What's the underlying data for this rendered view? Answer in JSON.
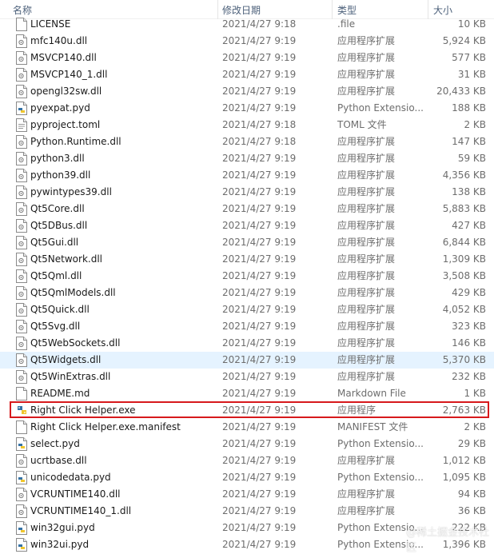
{
  "columns": {
    "name": "名称",
    "date": "修改日期",
    "type": "类型",
    "size": "大小"
  },
  "files": [
    {
      "name": "LICENSE",
      "date": "2021/4/27 9:18",
      "type": ".file",
      "size": "10 KB",
      "icon": "file-icon"
    },
    {
      "name": "mfc140u.dll",
      "date": "2021/4/27 9:19",
      "type": "应用程序扩展",
      "size": "5,924 KB",
      "icon": "dll-icon"
    },
    {
      "name": "MSVCP140.dll",
      "date": "2021/4/27 9:19",
      "type": "应用程序扩展",
      "size": "577 KB",
      "icon": "dll-icon"
    },
    {
      "name": "MSVCP140_1.dll",
      "date": "2021/4/27 9:19",
      "type": "应用程序扩展",
      "size": "31 KB",
      "icon": "dll-icon"
    },
    {
      "name": "opengl32sw.dll",
      "date": "2021/4/27 9:19",
      "type": "应用程序扩展",
      "size": "20,433 KB",
      "icon": "dll-icon"
    },
    {
      "name": "pyexpat.pyd",
      "date": "2021/4/27 9:19",
      "type": "Python Extensio...",
      "size": "188 KB",
      "icon": "python-icon"
    },
    {
      "name": "pyproject.toml",
      "date": "2021/4/27 9:18",
      "type": "TOML 文件",
      "size": "2 KB",
      "icon": "toml-icon"
    },
    {
      "name": "Python.Runtime.dll",
      "date": "2021/4/27 9:18",
      "type": "应用程序扩展",
      "size": "147 KB",
      "icon": "dll-icon"
    },
    {
      "name": "python3.dll",
      "date": "2021/4/27 9:19",
      "type": "应用程序扩展",
      "size": "59 KB",
      "icon": "dll-icon"
    },
    {
      "name": "python39.dll",
      "date": "2021/4/27 9:19",
      "type": "应用程序扩展",
      "size": "4,356 KB",
      "icon": "dll-icon"
    },
    {
      "name": "pywintypes39.dll",
      "date": "2021/4/27 9:19",
      "type": "应用程序扩展",
      "size": "138 KB",
      "icon": "dll-icon"
    },
    {
      "name": "Qt5Core.dll",
      "date": "2021/4/27 9:19",
      "type": "应用程序扩展",
      "size": "5,883 KB",
      "icon": "dll-icon"
    },
    {
      "name": "Qt5DBus.dll",
      "date": "2021/4/27 9:19",
      "type": "应用程序扩展",
      "size": "427 KB",
      "icon": "dll-icon"
    },
    {
      "name": "Qt5Gui.dll",
      "date": "2021/4/27 9:19",
      "type": "应用程序扩展",
      "size": "6,844 KB",
      "icon": "dll-icon"
    },
    {
      "name": "Qt5Network.dll",
      "date": "2021/4/27 9:19",
      "type": "应用程序扩展",
      "size": "1,309 KB",
      "icon": "dll-icon"
    },
    {
      "name": "Qt5Qml.dll",
      "date": "2021/4/27 9:19",
      "type": "应用程序扩展",
      "size": "3,508 KB",
      "icon": "dll-icon"
    },
    {
      "name": "Qt5QmlModels.dll",
      "date": "2021/4/27 9:19",
      "type": "应用程序扩展",
      "size": "429 KB",
      "icon": "dll-icon"
    },
    {
      "name": "Qt5Quick.dll",
      "date": "2021/4/27 9:19",
      "type": "应用程序扩展",
      "size": "4,052 KB",
      "icon": "dll-icon"
    },
    {
      "name": "Qt5Svg.dll",
      "date": "2021/4/27 9:19",
      "type": "应用程序扩展",
      "size": "323 KB",
      "icon": "dll-icon"
    },
    {
      "name": "Qt5WebSockets.dll",
      "date": "2021/4/27 9:19",
      "type": "应用程序扩展",
      "size": "146 KB",
      "icon": "dll-icon"
    },
    {
      "name": "Qt5Widgets.dll",
      "date": "2021/4/27 9:19",
      "type": "应用程序扩展",
      "size": "5,370 KB",
      "icon": "dll-icon",
      "selected": true
    },
    {
      "name": "Qt5WinExtras.dll",
      "date": "2021/4/27 9:19",
      "type": "应用程序扩展",
      "size": "232 KB",
      "icon": "dll-icon"
    },
    {
      "name": "README.md",
      "date": "2021/4/27 9:19",
      "type": "Markdown File",
      "size": "1 KB",
      "icon": "file-icon"
    },
    {
      "name": "Right Click Helper.exe",
      "date": "2021/4/27 9:19",
      "type": "应用程序",
      "size": "2,763 KB",
      "icon": "exe-icon",
      "highlighted": true
    },
    {
      "name": "Right Click Helper.exe.manifest",
      "date": "2021/4/27 9:19",
      "type": "MANIFEST 文件",
      "size": "2 KB",
      "icon": "file-icon"
    },
    {
      "name": "select.pyd",
      "date": "2021/4/27 9:19",
      "type": "Python Extensio...",
      "size": "29 KB",
      "icon": "python-icon"
    },
    {
      "name": "ucrtbase.dll",
      "date": "2021/4/27 9:19",
      "type": "应用程序扩展",
      "size": "1,012 KB",
      "icon": "dll-icon"
    },
    {
      "name": "unicodedata.pyd",
      "date": "2021/4/27 9:19",
      "type": "Python Extensio...",
      "size": "1,095 KB",
      "icon": "python-icon"
    },
    {
      "name": "VCRUNTIME140.dll",
      "date": "2021/4/27 9:19",
      "type": "应用程序扩展",
      "size": "94 KB",
      "icon": "dll-icon"
    },
    {
      "name": "VCRUNTIME140_1.dll",
      "date": "2021/4/27 9:19",
      "type": "应用程序扩展",
      "size": "36 KB",
      "icon": "dll-icon"
    },
    {
      "name": "win32gui.pyd",
      "date": "2021/4/27 9:19",
      "type": "Python Extensio...",
      "size": "222 KB",
      "icon": "python-icon"
    },
    {
      "name": "win32ui.pyd",
      "date": "2021/4/27 9:19",
      "type": "Python Extensio...",
      "size": "1,396 KB",
      "icon": "python-icon"
    }
  ],
  "watermark": "@稀土掘金技术社区",
  "colors": {
    "highlight_border": "#d7191c",
    "selected_row": "#e5f3ff",
    "header_text": "#4c607a",
    "meta_text": "#6d6d6d"
  }
}
